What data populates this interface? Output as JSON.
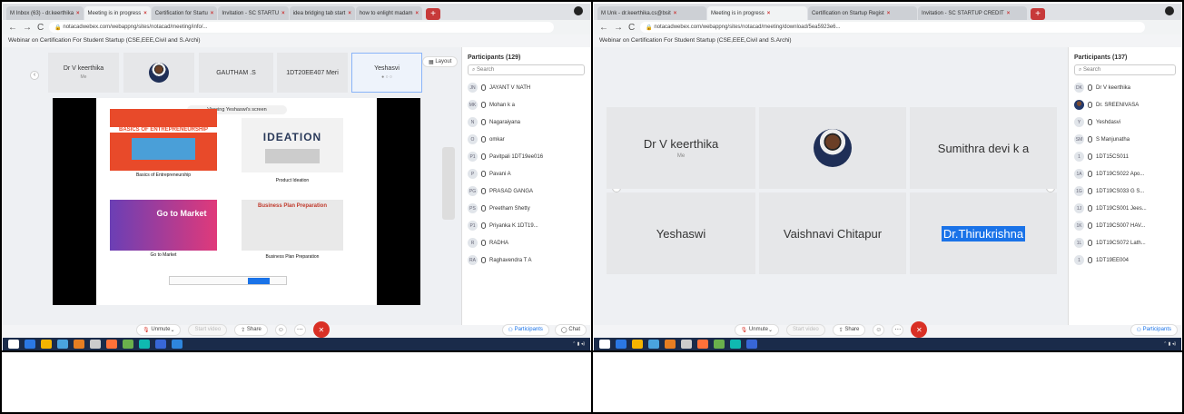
{
  "left": {
    "tabs": [
      "M Inbox (63) - dr.keerthika",
      "Meeting is in progress",
      "Certification for Startu",
      "Invitation - SC STARTU",
      "idea bridging tab start",
      "how to enlight madam"
    ],
    "url": "notacadwebex.com/webappng/sites/notacad/meeting/info/...",
    "title": "Webinar on Certification For Student Startup (CSE,EEE,Civil and S.Archi)",
    "tiles": [
      {
        "name": "Dr V keerthika",
        "sub": "Me"
      },
      {
        "name": "",
        "sub": ""
      },
      {
        "name": "GAUTHAM .S",
        "sub": ""
      },
      {
        "name": "1DT20EE407 Meri",
        "sub": ""
      },
      {
        "name": "Yeshasvi",
        "sub": ""
      }
    ],
    "layout_btn": "Layout",
    "viewing_banner": "Viewing Yeshaswi's screen",
    "slides": [
      {
        "heading": "BASICS OF ENTREPRENEURSHIP",
        "caption": "Basics of Entrepreneurship"
      },
      {
        "heading": "IDEATION",
        "caption": "Product Ideation"
      },
      {
        "heading": "Go to Market",
        "caption": "Go to Market"
      },
      {
        "heading": "Business Plan Preparation",
        "caption": "Business Plan Preparation"
      }
    ],
    "participants_title": "Participants (129)",
    "search_placeholder": "Search",
    "participants": [
      {
        "initials": "JN",
        "name": "JAYANT V NATH"
      },
      {
        "initials": "MK",
        "name": "Mohan k a"
      },
      {
        "initials": "N",
        "name": "Nagaraiyana"
      },
      {
        "initials": "O",
        "name": "omkar"
      },
      {
        "initials": "P1",
        "name": "Pavitpali 1DT19ee016"
      },
      {
        "initials": "P",
        "name": "Pavani A"
      },
      {
        "initials": "PG",
        "name": "PRASAD GANGA"
      },
      {
        "initials": "PS",
        "name": "Preetham Shetty"
      },
      {
        "initials": "P1",
        "name": "Priyanka K 1DT19..."
      },
      {
        "initials": "R",
        "name": "RADHA"
      },
      {
        "initials": "RA",
        "name": "Raghavendra T A"
      }
    ],
    "toolbar": {
      "unmute": "Unmute",
      "start_video": "Start video",
      "share": "Share",
      "participants": "Participants",
      "chat": "Chat"
    }
  },
  "right": {
    "tabs": [
      "M Unk - dr.keerthika.cs@bsit",
      "Meeting is in progress",
      "Certification on Startup Regist",
      "Invitation - SC STARTUP CREDIT"
    ],
    "url": "notacadwebex.com/webappng/sites/notacad/meeting/download/5ea5923e6...",
    "title": "Webinar on Certification For Student Startup (CSE,EEE,Civil and S.Archi)",
    "tiles": [
      {
        "name": "Dr V keerthika",
        "sub": "Me"
      },
      {
        "name": "",
        "sub": ""
      },
      {
        "name": "Sumithra devi k a",
        "sub": ""
      },
      {
        "name": "Yeshaswi",
        "sub": ""
      },
      {
        "name": "Vaishnavi Chitapur",
        "sub": ""
      },
      {
        "name": "Dr.Thirukrishna",
        "sub": ""
      }
    ],
    "participants_title": "Participants (137)",
    "search_placeholder": "Search",
    "participants": [
      {
        "initials": "DK",
        "name": "Dr V keerthika"
      },
      {
        "initials": "",
        "name": "Dr. SREENIVASA"
      },
      {
        "initials": "Y",
        "name": "Yeshdasvi"
      },
      {
        "initials": "SM",
        "name": "S Manjunatha"
      },
      {
        "initials": "1",
        "name": "1DT15CS011"
      },
      {
        "initials": "1A",
        "name": "1DT19CS022 Apo..."
      },
      {
        "initials": "1G",
        "name": "1DT19CS033 G S..."
      },
      {
        "initials": "1J",
        "name": "1DT19CS001 Jees..."
      },
      {
        "initials": "1K",
        "name": "1DT19CS007 HAV..."
      },
      {
        "initials": "1L",
        "name": "1DT19CS072 Lath..."
      },
      {
        "initials": "1",
        "name": "1DT19EE004"
      }
    ],
    "toolbar": {
      "unmute": "Unmute",
      "start_video": "Start video",
      "share": "Share",
      "participants": "Participants"
    }
  },
  "colors": {
    "accent": "#1a73e8",
    "end_call": "#d93025",
    "taskbar": "#1a2b4a",
    "highlight": "#1a73e8"
  }
}
